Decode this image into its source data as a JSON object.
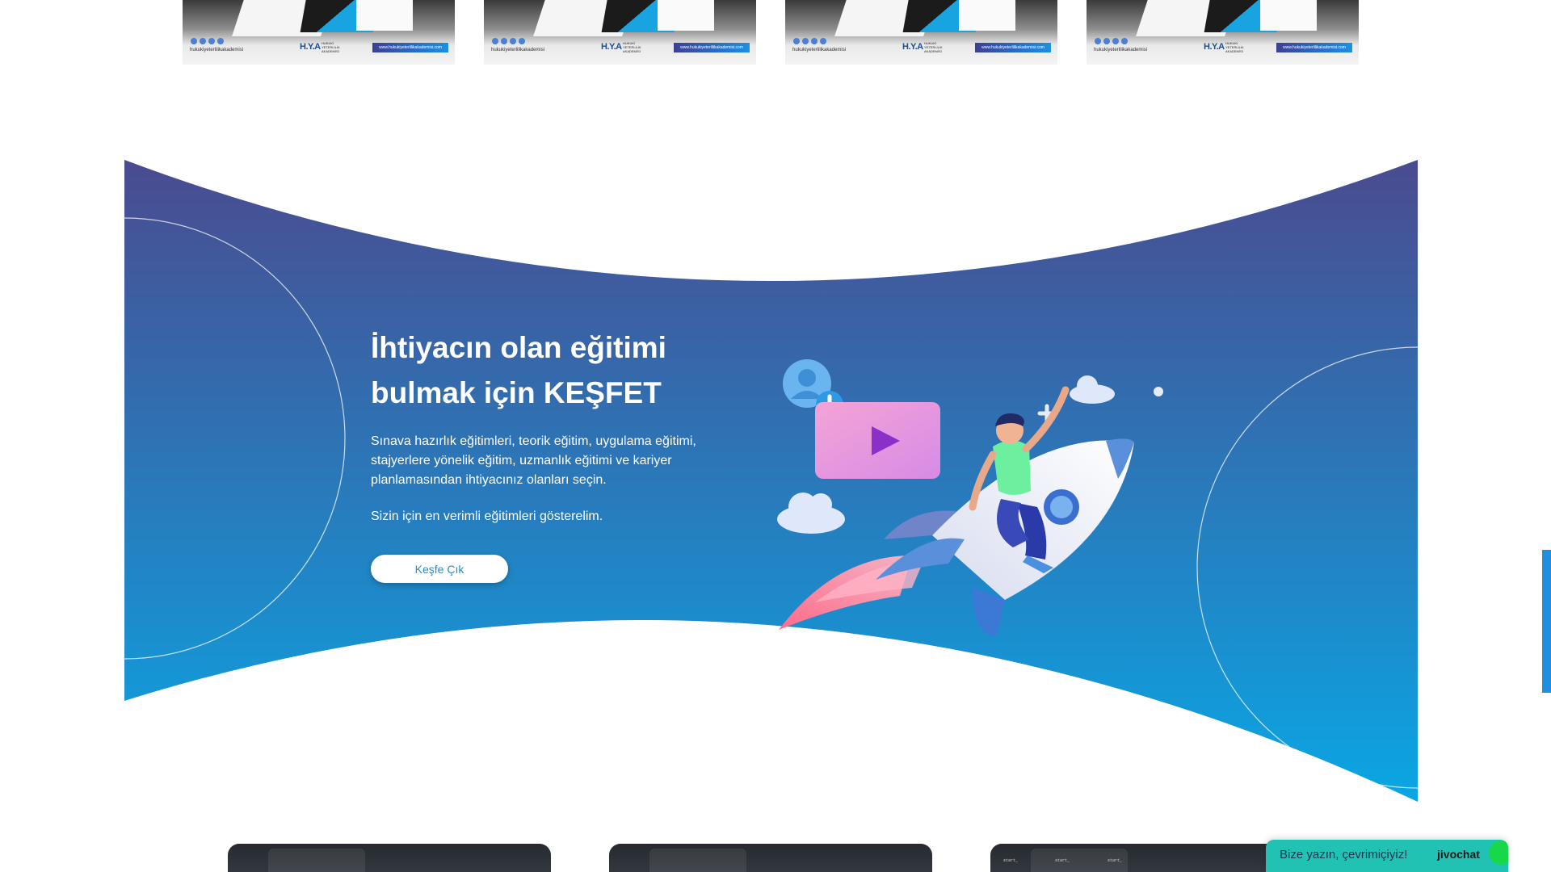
{
  "product_cards": [
    {
      "handle": "hukukiyeterlilikakademisi",
      "logo": "H.Y.A",
      "logo_sub": "HUKUKİ YETERLİLİK AKADEMİSİ",
      "url": "www.hukukiyeterlilikakademisi.com"
    },
    {
      "handle": "hukukiyeterlilikakademisi",
      "logo": "H.Y.A",
      "logo_sub": "HUKUKİ YETERLİLİK AKADEMİSİ",
      "url": "www.hukukiyeterlilikakademisi.com"
    },
    {
      "handle": "hukukiyeterlilikakademisi",
      "logo": "H.Y.A",
      "logo_sub": "HUKUKİ YETERLİLİK AKADEMİSİ",
      "url": "www.hukukiyeterlilikakademisi.com"
    },
    {
      "handle": "hukukiyeterlilikakademisi",
      "logo": "H.Y.A",
      "logo_sub": "HUKUKİ YETERLİLİK AKADEMİSİ",
      "url": "www.hukukiyeterlilikakademisi.com"
    }
  ],
  "hero": {
    "title_line1": "İhtiyacın olan eğitimi",
    "title_line2": "bulmak için KEŞFET",
    "description": "Sınava hazırlık eğitimleri, teorik eğitim, uygulama eğitimi, stajyerlere yönelik eğitim, uzmanlık eğitimi ve kariyer planlamasından ihtiyacınız olanları seçin.",
    "description2": "Sizin için en verimli eğitimleri gösterelim.",
    "button_label": "Keşfe Çık",
    "gradient_top": "#4a4b8f",
    "gradient_bottom": "#0aa6e4",
    "illustration": "rocket-boy-illustration"
  },
  "video_cards": [
    {
      "cmd": "start_"
    },
    {
      "cmd": "start_"
    },
    {
      "cmd": "start_"
    }
  ],
  "chat": {
    "prompt": "Bize yazın, çevrimiçiyiz!",
    "brand": "jivochat",
    "color": "#21c2b3"
  }
}
